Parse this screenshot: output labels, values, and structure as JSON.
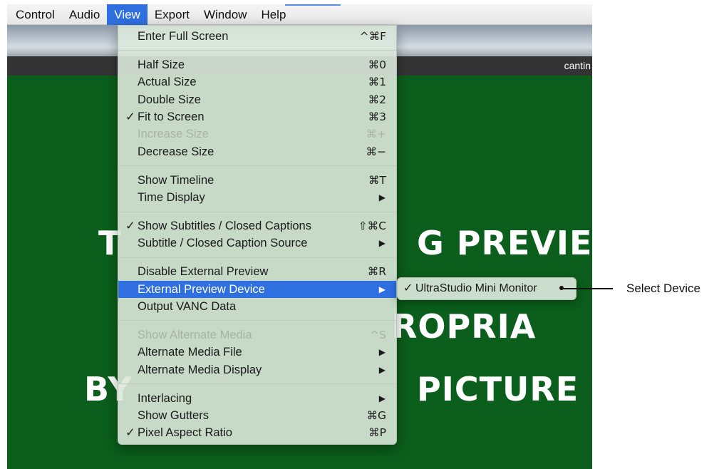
{
  "menubar": {
    "items": [
      "Control",
      "Audio",
      "View",
      "Export",
      "Window",
      "Help"
    ],
    "active": "View"
  },
  "window": {
    "title_fragment": "cantin",
    "video_text": {
      "line1_left": "T",
      "line1_right": "G PREVIEV",
      "line2_right": "ROPRIA",
      "line3_left": "BY",
      "line3_right": "PICTURE"
    },
    "background_color": "#0b5e1b"
  },
  "view_menu": {
    "items": [
      {
        "label": "Enter Full Screen",
        "shortcut": "^⌘F"
      },
      {
        "separator": true
      },
      {
        "label": "Half Size",
        "shortcut": "⌘0"
      },
      {
        "label": "Actual Size",
        "shortcut": "⌘1"
      },
      {
        "label": "Double Size",
        "shortcut": "⌘2"
      },
      {
        "label": "Fit to Screen",
        "shortcut": "⌘3",
        "checked": true
      },
      {
        "label": "Increase Size",
        "shortcut": "⌘+",
        "disabled": true
      },
      {
        "label": "Decrease Size",
        "shortcut": "⌘−"
      },
      {
        "separator": true
      },
      {
        "label": "Show Timeline",
        "shortcut": "⌘T"
      },
      {
        "label": "Time Display",
        "submenu": true
      },
      {
        "separator": true
      },
      {
        "label": "Show Subtitles / Closed Captions",
        "shortcut": "⇧⌘C",
        "checked": true
      },
      {
        "label": "Subtitle / Closed Caption Source",
        "submenu": true
      },
      {
        "separator": true
      },
      {
        "label": "Disable External Preview",
        "shortcut": "⌘R"
      },
      {
        "label": "External Preview Device",
        "submenu": true,
        "highlighted": true
      },
      {
        "label": "Output VANC Data"
      },
      {
        "separator": true
      },
      {
        "label": "Show Alternate Media",
        "shortcut": "^S",
        "disabled": true
      },
      {
        "label": "Alternate Media File",
        "submenu": true
      },
      {
        "label": "Alternate Media Display",
        "submenu": true
      },
      {
        "separator": true
      },
      {
        "label": "Interlacing",
        "submenu": true
      },
      {
        "label": "Show Gutters",
        "shortcut": "⌘G"
      },
      {
        "label": "Pixel Aspect Ratio",
        "shortcut": "⌘P",
        "checked": true
      }
    ]
  },
  "submenu": {
    "items": [
      {
        "label": "UltraStudio Mini Monitor",
        "checked": true
      }
    ]
  },
  "callout": {
    "text": "Select Device"
  },
  "glyphs": {
    "check": "✓",
    "arrow": "▶"
  }
}
